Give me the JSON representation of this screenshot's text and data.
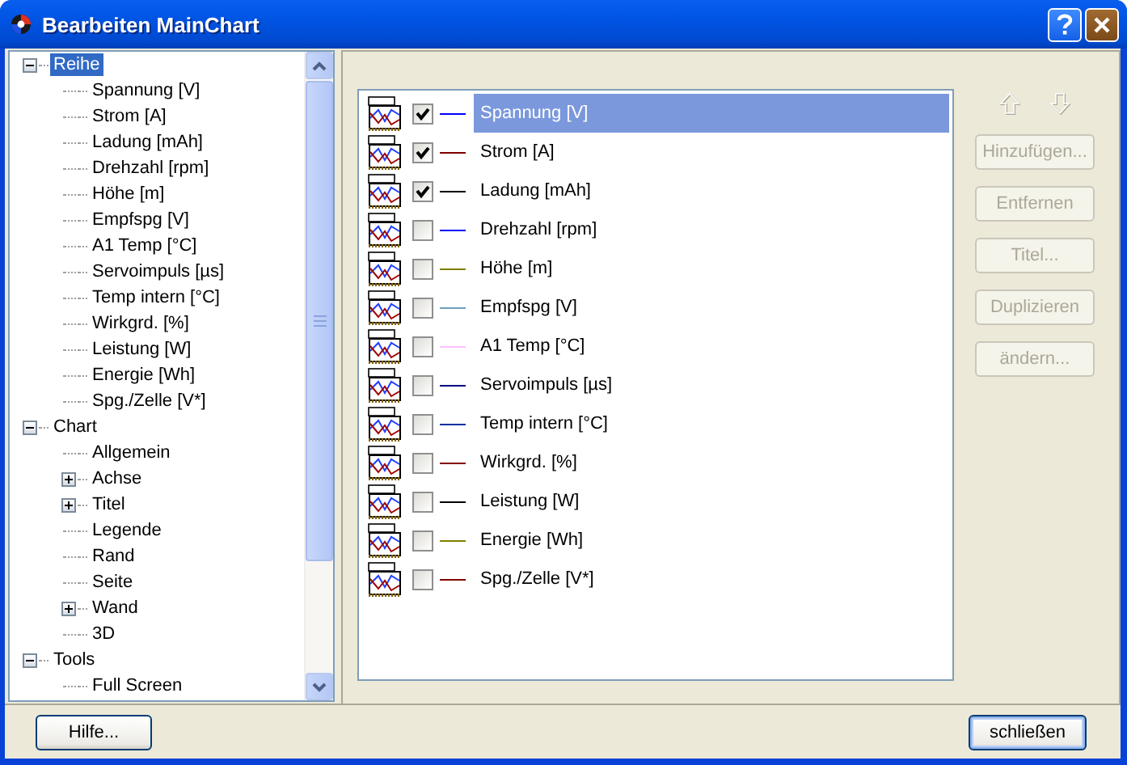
{
  "window": {
    "title": "Bearbeiten MainChart"
  },
  "tree": {
    "items": [
      {
        "label": "Reihe",
        "kind": "node",
        "expanded": true,
        "selected": true,
        "children": [
          {
            "label": "Spannung [V]",
            "kind": "leaf",
            "selected": false
          },
          {
            "label": "Strom [A]",
            "kind": "leaf",
            "selected": false
          },
          {
            "label": "Ladung [mAh]",
            "kind": "leaf",
            "selected": false
          },
          {
            "label": "Drehzahl [rpm]",
            "kind": "leaf",
            "selected": false
          },
          {
            "label": "Höhe [m]",
            "kind": "leaf",
            "selected": false
          },
          {
            "label": "Empfspg [V]",
            "kind": "leaf",
            "selected": false
          },
          {
            "label": "A1 Temp [°C]",
            "kind": "leaf",
            "selected": false
          },
          {
            "label": "Servoimpuls [µs]",
            "kind": "leaf",
            "selected": false
          },
          {
            "label": "Temp intern [°C]",
            "kind": "leaf",
            "selected": false
          },
          {
            "label": "Wirkgrd. [%]",
            "kind": "leaf",
            "selected": false
          },
          {
            "label": "Leistung [W]",
            "kind": "leaf",
            "selected": false
          },
          {
            "label": "Energie [Wh]",
            "kind": "leaf",
            "selected": false
          },
          {
            "label": "Spg./Zelle [V*]",
            "kind": "leaf",
            "selected": false
          }
        ]
      },
      {
        "label": "Chart",
        "kind": "node",
        "expanded": true,
        "selected": false,
        "children": [
          {
            "label": "Allgemein",
            "kind": "leaf",
            "selected": false
          },
          {
            "label": "Achse",
            "kind": "node",
            "expanded": false,
            "selected": false
          },
          {
            "label": "Titel",
            "kind": "node",
            "expanded": false,
            "selected": false
          },
          {
            "label": "Legende",
            "kind": "leaf",
            "selected": false
          },
          {
            "label": "Rand",
            "kind": "leaf",
            "selected": false
          },
          {
            "label": "Seite",
            "kind": "leaf",
            "selected": false
          },
          {
            "label": "Wand",
            "kind": "node",
            "expanded": false,
            "selected": false
          },
          {
            "label": "3D",
            "kind": "leaf",
            "selected": false
          }
        ]
      },
      {
        "label": "Tools",
        "kind": "node",
        "expanded": true,
        "selected": false,
        "children": [
          {
            "label": "Full Screen",
            "kind": "leaf",
            "selected": false
          }
        ]
      }
    ]
  },
  "series": [
    {
      "name": "Spannung [V]",
      "checked": true,
      "selected": true,
      "color": "#0000ff"
    },
    {
      "name": "Strom [A]",
      "checked": true,
      "selected": false,
      "color": "#800000"
    },
    {
      "name": "Ladung [mAh]",
      "checked": true,
      "selected": false,
      "color": "#000000"
    },
    {
      "name": "Drehzahl [rpm]",
      "checked": false,
      "selected": false,
      "color": "#0000ff"
    },
    {
      "name": "Höhe [m]",
      "checked": false,
      "selected": false,
      "color": "#808000"
    },
    {
      "name": "Empfspg [V]",
      "checked": false,
      "selected": false,
      "color": "#6f9fc0"
    },
    {
      "name": "A1 Temp [°C]",
      "checked": false,
      "selected": false,
      "color": "#ffc0ff"
    },
    {
      "name": "Servoimpuls [µs]",
      "checked": false,
      "selected": false,
      "color": "#000080"
    },
    {
      "name": "Temp intern [°C]",
      "checked": false,
      "selected": false,
      "color": "#0030a0"
    },
    {
      "name": "Wirkgrd. [%]",
      "checked": false,
      "selected": false,
      "color": "#800000"
    },
    {
      "name": "Leistung [W]",
      "checked": false,
      "selected": false,
      "color": "#000000"
    },
    {
      "name": "Energie [Wh]",
      "checked": false,
      "selected": false,
      "color": "#808000"
    },
    {
      "name": "Spg./Zelle [V*]",
      "checked": false,
      "selected": false,
      "color": "#800000"
    }
  ],
  "move_buttons": [
    {
      "kind": "up",
      "disabled": true
    },
    {
      "kind": "down",
      "disabled": true
    }
  ],
  "buttons": [
    {
      "label": "Hinzufügen...",
      "disabled": true
    },
    {
      "label": "Entfernen",
      "disabled": true
    },
    {
      "label": "Titel...",
      "disabled": true
    },
    {
      "label": "Duplizieren",
      "disabled": true
    },
    {
      "label": "ändern...",
      "disabled": true
    }
  ],
  "footer_buttons": [
    {
      "label": "Hilfe...",
      "kind": "help"
    },
    {
      "label": "schließen",
      "kind": "close"
    }
  ]
}
